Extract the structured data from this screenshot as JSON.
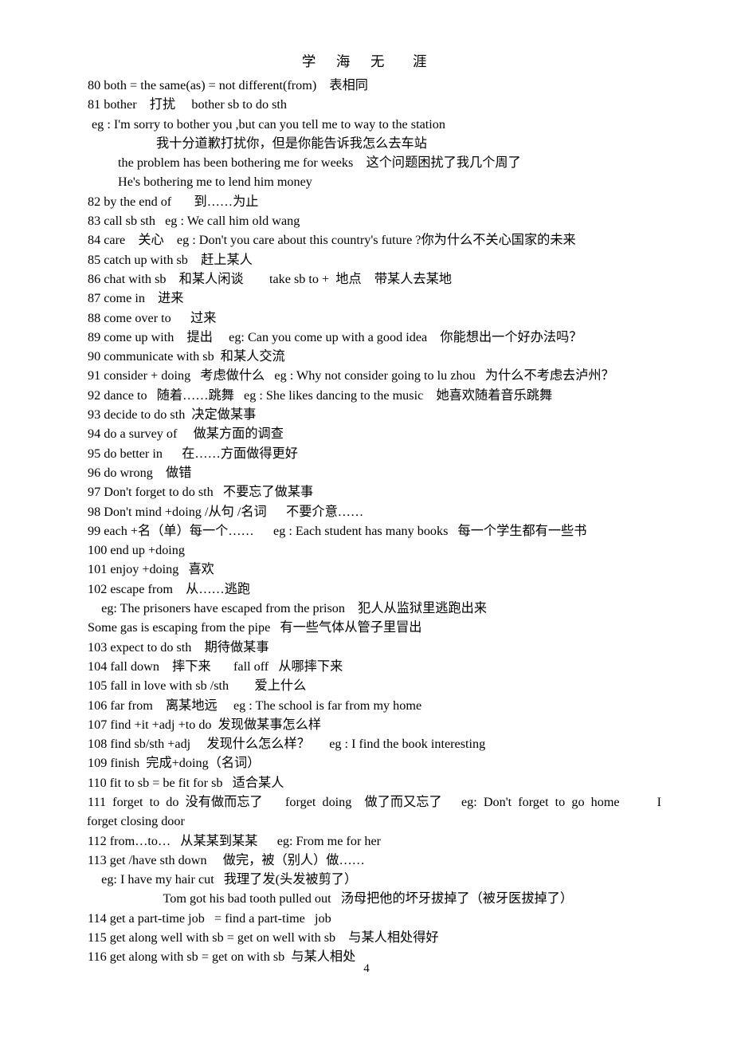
{
  "document": {
    "header": "学  海  无   涯",
    "page_number": "4",
    "lines": [
      {
        "id": "l80",
        "indent": "i0",
        "text": "80 both = the same(as) = not different(from)    表相同"
      },
      {
        "id": "l81",
        "indent": "i0",
        "text": "81 bother    打扰     bother sb to do sth"
      },
      {
        "id": "l81eg",
        "indent": "i1",
        "text": "eg : I'm sorry to bother you ,but can you tell me to way to the station"
      },
      {
        "id": "l81cn",
        "indent": "i3",
        "text": "我十分道歉打扰你，但是你能告诉我怎么去车站"
      },
      {
        "id": "l81b",
        "indent": "i2",
        "text": "the problem has been bothering me for weeks    这个问题困扰了我几个周了"
      },
      {
        "id": "l81c",
        "indent": "i2",
        "text": "He's bothering me to lend him money"
      },
      {
        "id": "l82",
        "indent": "i0",
        "text": "82 by the end of       到……为止"
      },
      {
        "id": "l83",
        "indent": "i0",
        "text": "83 call sb sth   eg : We call him old wang"
      },
      {
        "id": "l84",
        "indent": "i0",
        "text": "84 care    关心    eg : Don't you care about this country's future ?你为什么不关心国家的未来"
      },
      {
        "id": "l85",
        "indent": "i0",
        "text": "85 catch up with sb    赶上某人"
      },
      {
        "id": "l86",
        "indent": "i0",
        "text": "86 chat with sb    和某人闲谈        take sb to +  地点    带某人去某地"
      },
      {
        "id": "l87",
        "indent": "i0",
        "text": "87 come in    进来"
      },
      {
        "id": "l88",
        "indent": "i0",
        "text": "88 come over to      过来"
      },
      {
        "id": "l89",
        "indent": "i0",
        "text": "89 come up with    提出     eg: Can you come up with a good idea    你能想出一个好办法吗？"
      },
      {
        "id": "l90",
        "indent": "i0",
        "text": "90 communicate with sb  和某人交流"
      },
      {
        "id": "l91",
        "indent": "i0",
        "text": "91 consider + doing   考虑做什么   eg : Why not consider going to lu zhou   为什么不考虑去泸州？"
      },
      {
        "id": "l92",
        "indent": "i0",
        "text": "92 dance to   随着……跳舞   eg : She likes dancing to the music    她喜欢随着音乐跳舞"
      },
      {
        "id": "l93",
        "indent": "i0",
        "text": "93 decide to do sth  决定做某事"
      },
      {
        "id": "l94",
        "indent": "i0",
        "text": "94 do a survey of     做某方面的调查"
      },
      {
        "id": "l95",
        "indent": "i0",
        "text": "95 do better in      在……方面做得更好"
      },
      {
        "id": "l96",
        "indent": "i0",
        "text": "96 do wrong    做错"
      },
      {
        "id": "l97",
        "indent": "i0",
        "text": "97 Don't forget to do sth   不要忘了做某事"
      },
      {
        "id": "l98",
        "indent": "i0",
        "text": "98 Don't mind +doing /从句 /名词      不要介意……"
      },
      {
        "id": "l99",
        "indent": "i0",
        "text": "99 each +名（单）每一个……      eg : Each student has many books   每一个学生都有一些书"
      },
      {
        "id": "l100",
        "indent": "i0",
        "text": "100 end up +doing"
      },
      {
        "id": "l101",
        "indent": "i0",
        "text": "101 enjoy +doing   喜欢"
      },
      {
        "id": "l102",
        "indent": "i0",
        "text": "102 escape from    从……逃跑"
      },
      {
        "id": "l102eg",
        "indent": "i1",
        "text": "   eg: The prisoners have escaped from the prison    犯人从监狱里逃跑出来"
      },
      {
        "id": "l102b",
        "indent": "i0",
        "text": "Some gas is escaping from the pipe   有一些气体从管子里冒出"
      },
      {
        "id": "l103",
        "indent": "i0",
        "text": "103 expect to do sth    期待做某事"
      },
      {
        "id": "l104",
        "indent": "i0",
        "text": "104 fall down    摔下来       fall off   从哪摔下来"
      },
      {
        "id": "l105",
        "indent": "i0",
        "text": "105 fall in love with sb /sth        爱上什么"
      },
      {
        "id": "l106",
        "indent": "i0",
        "text": "106 far from    离某地远     eg : The school is far from my home"
      },
      {
        "id": "l107",
        "indent": "i0",
        "text": "107 find +it +adj +to do  发现做某事怎么样"
      },
      {
        "id": "l108",
        "indent": "i0",
        "text": "108 find sb/sth +adj     发现什么怎么样？      eg : I find the book interesting"
      },
      {
        "id": "l109",
        "indent": "i0",
        "text": "109 finish  完成+doing（名词）"
      },
      {
        "id": "l110",
        "indent": "i0",
        "text": "110 fit to sb = be fit for sb   适合某人"
      },
      {
        "id": "l111a",
        "indent": "i0",
        "text": "111  forget  to  do  没有做而忘了       forget  doing    做了而又忘了      eg:  Don't  forget  to  go  home"
      },
      {
        "id": "l111tail",
        "indent": "i0",
        "text": "I"
      },
      {
        "id": "l111b",
        "indent": "i6",
        "text": "forget closing door"
      },
      {
        "id": "l112",
        "indent": "i0",
        "text": "112 from…to…   从某某到某某      eg: From me for her"
      },
      {
        "id": "l113",
        "indent": "i0",
        "text": "113 get /have sth down     做完，被（别人）做……"
      },
      {
        "id": "l113eg",
        "indent": "i1",
        "text": "   eg: I have my hair cut   我理了发(头发被剪了）"
      },
      {
        "id": "l113b",
        "indent": "i4",
        "text": "           Tom got his bad tooth pulled out   汤母把他的坏牙拔掉了（被牙医拔掉了）"
      },
      {
        "id": "l114",
        "indent": "i0",
        "text": "114 get a part-time job   = find a part-time   job"
      },
      {
        "id": "l115",
        "indent": "i0",
        "text": "115 get along well with sb = get on well with sb    与某人相处得好"
      },
      {
        "id": "l116",
        "indent": "i0",
        "text": "116 get along with sb = get on with sb  与某人相处"
      }
    ]
  }
}
